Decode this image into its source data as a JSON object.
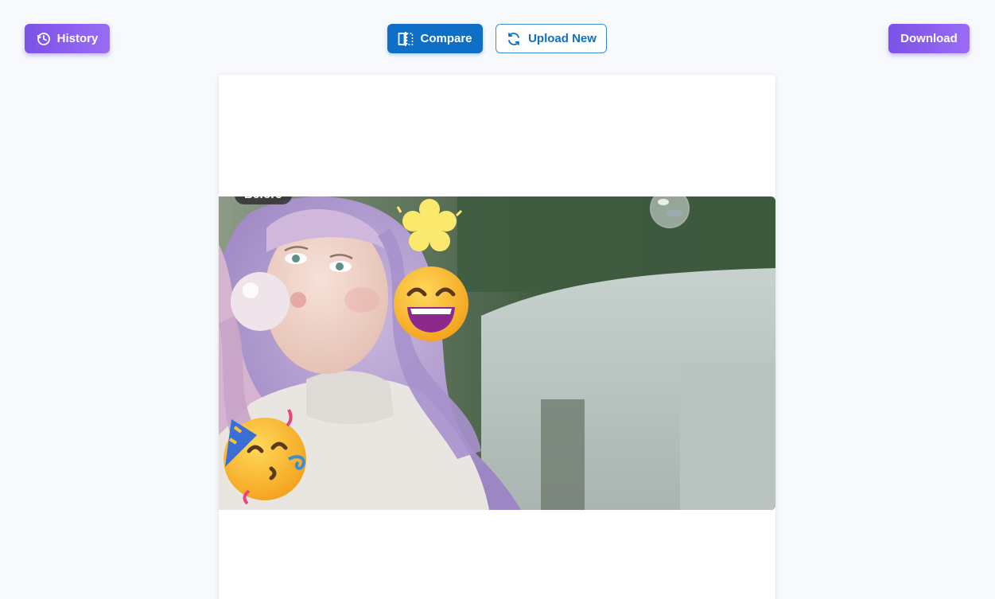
{
  "toolbar": {
    "history_label": "History",
    "history_icon": "clock-history-icon",
    "compare_label": "Compare",
    "compare_icon": "compare-split-icon",
    "upload_label": "Upload New",
    "upload_icon": "refresh-arrows-icon",
    "download_label": "Download"
  },
  "canvas": {
    "badge_label": "Before",
    "stickers": [
      "sparkle-flower-sticker",
      "grinning-face-sticker",
      "partying-face-sticker",
      "bubble-sticker"
    ]
  },
  "colors": {
    "accent_purple": "#7b52e6",
    "accent_blue": "#0f6fc6",
    "background": "#f7f9fc"
  }
}
